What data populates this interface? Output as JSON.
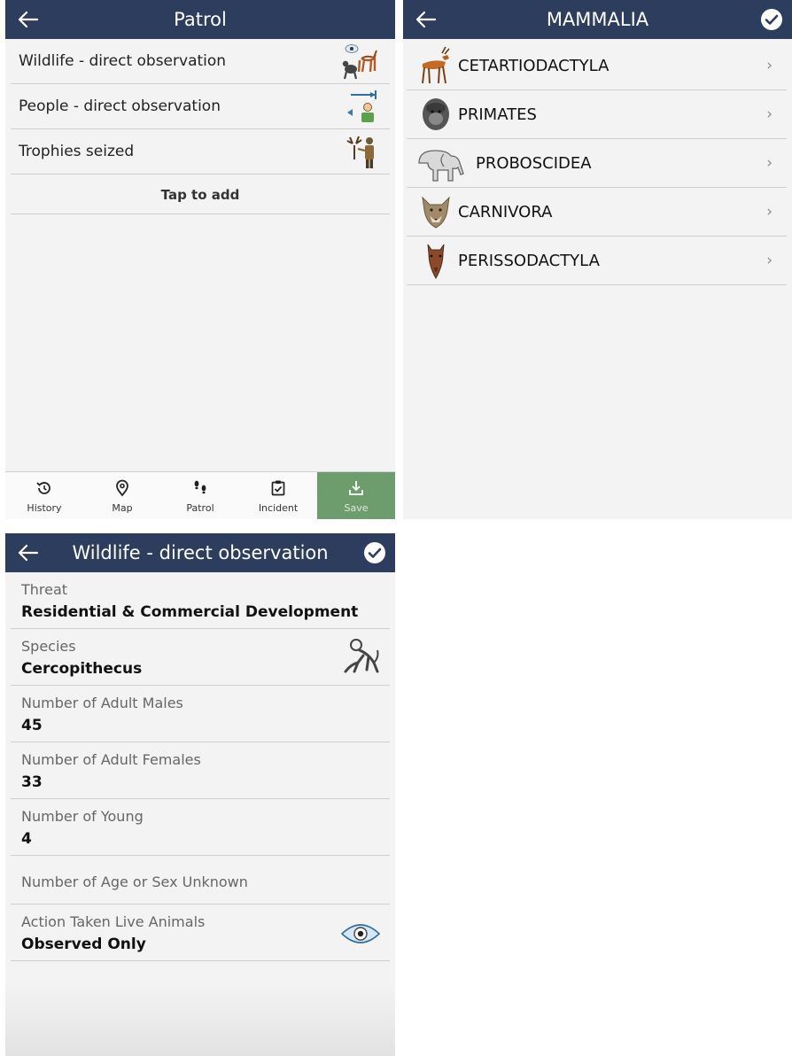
{
  "patrol": {
    "title": "Patrol",
    "items": [
      {
        "label": "Wildlife - direct observation",
        "icon": "wildlife-observation-icon"
      },
      {
        "label": "People - direct observation",
        "icon": "people-observation-icon"
      },
      {
        "label": "Trophies seized",
        "icon": "trophies-seized-icon"
      }
    ],
    "tap_to_add": "Tap to add",
    "nav": [
      {
        "label": "History",
        "icon": "history-icon"
      },
      {
        "label": "Map",
        "icon": "map-pin-icon"
      },
      {
        "label": "Patrol",
        "icon": "footsteps-icon"
      },
      {
        "label": "Incident",
        "icon": "clipboard-check-icon"
      },
      {
        "label": "Save",
        "icon": "download-icon"
      }
    ]
  },
  "mammalia": {
    "title": "MAMMALIA",
    "items": [
      {
        "label": "CETARTIODACTYLA",
        "icon": "antelope-icon"
      },
      {
        "label": "PRIMATES",
        "icon": "gorilla-icon"
      },
      {
        "label": "PROBOSCIDEA",
        "icon": "elephant-icon"
      },
      {
        "label": "CARNIVORA",
        "icon": "wolf-icon"
      },
      {
        "label": "PERISSODACTYLA",
        "icon": "horse-icon"
      }
    ],
    "chevron": "›"
  },
  "wildlife": {
    "title": "Wildlife - direct observation",
    "fields": [
      {
        "label": "Threat",
        "value": "Residential & Commercial Development"
      },
      {
        "label": "Species",
        "value": "Cercopithecus",
        "icon": "monkey-icon"
      },
      {
        "label": "Number of Adult Males",
        "value": "45"
      },
      {
        "label": "Number of Adult Females",
        "value": "33"
      },
      {
        "label": "Number of Young",
        "value": "4"
      },
      {
        "label": "Number of Age or Sex Unknown",
        "value": ""
      },
      {
        "label": "Action Taken Live Animals",
        "value": "Observed Only",
        "icon": "eye-icon"
      }
    ]
  },
  "colors": {
    "header": "#2d3d5e",
    "save_button": "#6d9d6d",
    "background": "#f3f3f3"
  }
}
